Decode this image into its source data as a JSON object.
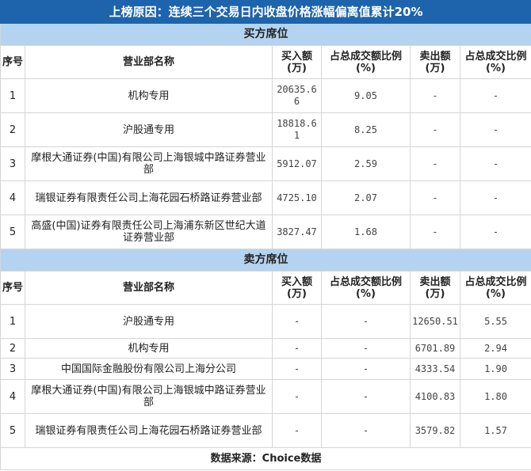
{
  "title": "上榜原因：连续三个交易日内收盘价格涨幅偏离值累计20%",
  "headers": [
    "序号",
    "营业部名称",
    "买入额(万)",
    "占总成交额比例(%)",
    "卖出额(万)",
    "占总成交比例(%)"
  ],
  "buy": {
    "label": "买方席位",
    "rows": [
      [
        "1",
        "机构专用",
        "20635.66",
        "9.05",
        "-",
        "-"
      ],
      [
        "2",
        "沪股通专用",
        "18818.61",
        "8.25",
        "-",
        "-"
      ],
      [
        "3",
        "摩根大通证券(中国)有限公司上海银城中路证券营业部",
        "5912.07",
        "2.59",
        "-",
        "-"
      ],
      [
        "4",
        "瑞银证券有限责任公司上海花园石桥路证券营业部",
        "4725.10",
        "2.07",
        "-",
        "-"
      ],
      [
        "5",
        "高盛(中国)证券有限责任公司上海浦东新区世纪大道证券营业部",
        "3827.47",
        "1.68",
        "-",
        "-"
      ]
    ]
  },
  "sell": {
    "label": "卖方席位",
    "rows": [
      [
        "1",
        "沪股通专用",
        "-",
        "-",
        "12650.51",
        "5.55"
      ],
      [
        "2",
        "机构专用",
        "-",
        "-",
        "6701.89",
        "2.94"
      ],
      [
        "3",
        "中国国际金融股份有限公司上海分公司",
        "-",
        "-",
        "4333.54",
        "1.90"
      ],
      [
        "4",
        "摩根大通证券(中国)有限公司上海银城中路证券营业部",
        "-",
        "-",
        "4100.83",
        "1.80"
      ],
      [
        "5",
        "瑞银证券有限责任公司上海花园石桥路证券营业部",
        "-",
        "-",
        "3579.82",
        "1.57"
      ]
    ]
  },
  "footer": "数据来源：Choice数据"
}
